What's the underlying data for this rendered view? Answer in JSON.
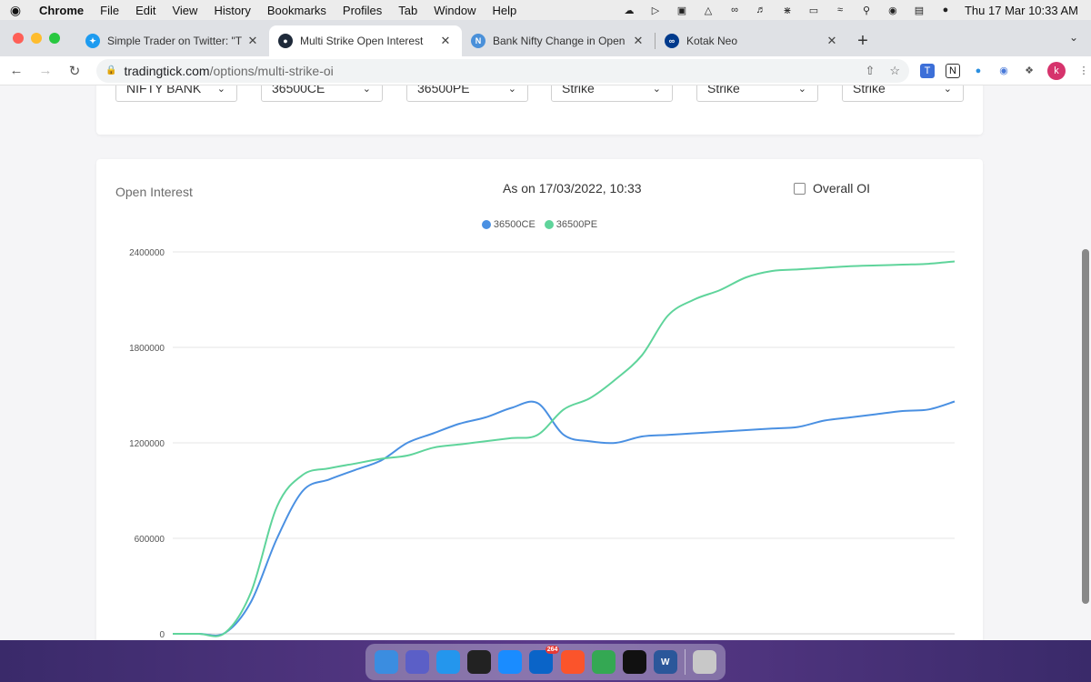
{
  "menubar": {
    "app_name": "Chrome",
    "items": [
      "File",
      "Edit",
      "View",
      "History",
      "Bookmarks",
      "Profiles",
      "Tab",
      "Window",
      "Help"
    ],
    "clock": "Thu 17 Mar  10:33 AM",
    "status_icons": [
      "creative-cloud-icon",
      "cast-icon",
      "screenshot-icon",
      "cube-icon",
      "paperclip-icon",
      "volume-icon",
      "bluetooth-icon",
      "battery-icon",
      "wifi-icon",
      "search-icon",
      "accessibility-icon",
      "control-center-icon",
      "siri-icon"
    ]
  },
  "tabs": [
    {
      "title": "Simple Trader on Twitter: \"Trad",
      "icon": "twitter-icon",
      "color": "#1d9bf0",
      "active": false
    },
    {
      "title": "Multi Strike Open Interest",
      "icon": "tradingtick-icon",
      "color": "#1f2a3a",
      "active": true
    },
    {
      "title": "Bank Nifty Change in Open Inte",
      "icon": "n-letter-icon",
      "color": "#4a90d9",
      "active": false
    },
    {
      "title": "Kotak Neo",
      "icon": "kotak-icon",
      "color": "#003a8c",
      "active": false
    }
  ],
  "address": {
    "host": "tradingtick.com",
    "path": "/options/multi-strike-oi"
  },
  "filters": [
    {
      "label": "NIFTY BANK"
    },
    {
      "label": "36500CE"
    },
    {
      "label": "36500PE"
    },
    {
      "label": "Strike"
    },
    {
      "label": "Strike"
    },
    {
      "label": "Strike"
    }
  ],
  "chart_card": {
    "title": "Open Interest",
    "as_on": "As on 17/03/2022, 10:33",
    "overall_label": "Overall OI",
    "overall_checked": false
  },
  "chart_data": {
    "type": "line",
    "title": "Open Interest",
    "ylim": [
      0,
      2400000
    ],
    "yticks": [
      0,
      600000,
      1200000,
      1800000,
      2400000
    ],
    "grid": true,
    "legend_position": "top-center",
    "x": [
      0,
      1,
      2,
      3,
      4,
      5,
      6,
      7,
      8,
      9,
      10,
      11,
      12,
      13,
      14,
      15,
      16,
      17,
      18,
      19,
      20,
      21,
      22,
      23,
      24,
      25,
      26,
      27,
      28,
      29,
      30
    ],
    "series": [
      {
        "name": "36500CE",
        "color": "#4a90e2",
        "values": [
          0,
          0,
          5000,
          200000,
          600000,
          900000,
          970000,
          1030000,
          1090000,
          1200000,
          1260000,
          1320000,
          1360000,
          1420000,
          1450000,
          1250000,
          1210000,
          1200000,
          1240000,
          1250000,
          1260000,
          1270000,
          1280000,
          1290000,
          1300000,
          1340000,
          1360000,
          1380000,
          1400000,
          1410000,
          1460000
        ]
      },
      {
        "name": "36500PE",
        "color": "#5fd49b",
        "values": [
          0,
          0,
          5000,
          260000,
          800000,
          1000000,
          1040000,
          1070000,
          1100000,
          1120000,
          1170000,
          1190000,
          1210000,
          1230000,
          1250000,
          1410000,
          1480000,
          1600000,
          1750000,
          2000000,
          2100000,
          2160000,
          2240000,
          2280000,
          2290000,
          2300000,
          2310000,
          2315000,
          2320000,
          2325000,
          2340000
        ]
      }
    ]
  },
  "dock": [
    {
      "icon": "finder-icon",
      "color": "#3b8de0",
      "label": ""
    },
    {
      "icon": "teams-icon",
      "color": "#5b5fc7",
      "label": ""
    },
    {
      "icon": "docker-icon",
      "color": "#2496ed",
      "label": ""
    },
    {
      "icon": "terminal-icon",
      "color": "#222222",
      "label": ""
    },
    {
      "icon": "safari-icon",
      "color": "#1a8cff",
      "label": ""
    },
    {
      "icon": "outlook-icon",
      "color": "#0a64c8",
      "label": "",
      "badge": "264"
    },
    {
      "icon": "brave-icon",
      "color": "#fb542b",
      "label": ""
    },
    {
      "icon": "chrome-icon",
      "color": "#34a853",
      "label": ""
    },
    {
      "icon": "tradingview-icon",
      "color": "#111111",
      "label": ""
    },
    {
      "icon": "word-icon",
      "color": "#2b579a",
      "label": "W"
    },
    {
      "icon": "trash-icon",
      "color": "#c8c8c8",
      "label": ""
    }
  ]
}
